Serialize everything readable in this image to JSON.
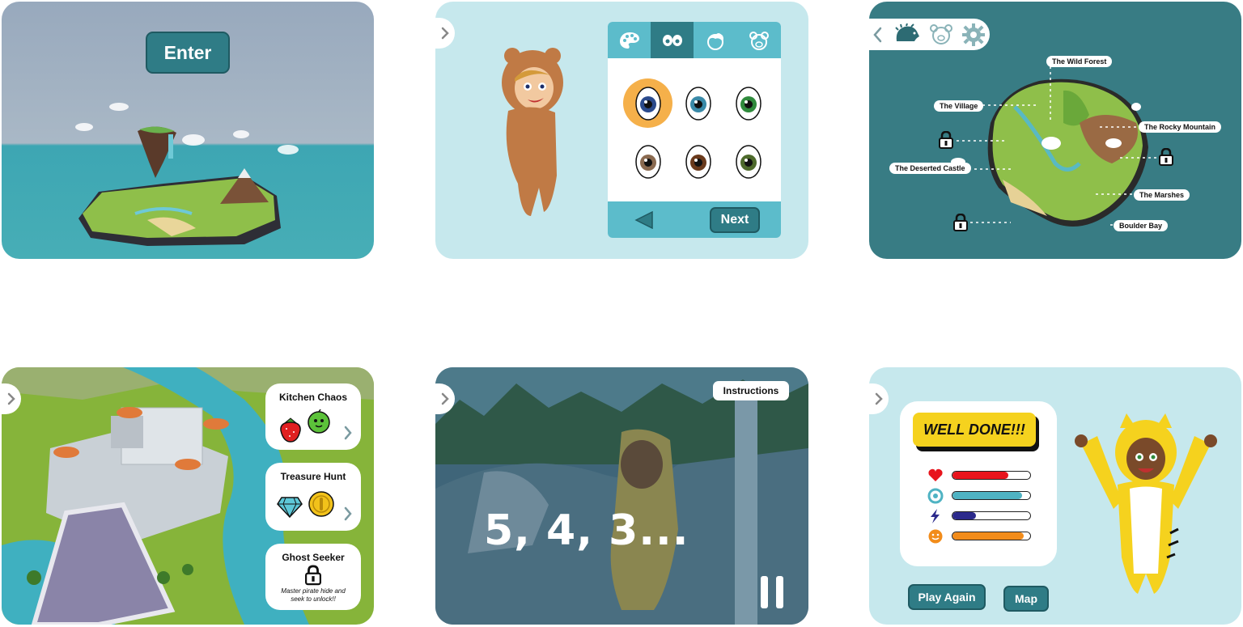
{
  "panels": {
    "enter": {
      "button_label": "Enter"
    },
    "customize": {
      "tabs": [
        {
          "icon": "palette-icon"
        },
        {
          "icon": "eyes-icon",
          "active": true
        },
        {
          "icon": "hair-icon"
        },
        {
          "icon": "bear-face-icon"
        }
      ],
      "eye_colors": [
        "#2a4a8c",
        "#3a8aa8",
        "#2f8a3c",
        "#8a6a50",
        "#6a3a1c",
        "#4e6a2c"
      ],
      "next_label": "Next"
    },
    "map": {
      "locations": [
        {
          "name": "The Wild Forest"
        },
        {
          "name": "The Village"
        },
        {
          "name": "The Rocky Mountain"
        },
        {
          "name": "The Deserted Castle"
        },
        {
          "name": "The Marshes"
        },
        {
          "name": "Boulder Bay"
        }
      ]
    },
    "castle": {
      "games": [
        {
          "title": "Kitchen Chaos"
        },
        {
          "title": "Treasure Hunt"
        },
        {
          "title": "Ghost Seeker",
          "locked_text": "Master pirate hide and seek to unlock!!"
        }
      ]
    },
    "countdown": {
      "instructions_label": "Instructions",
      "countdown_text": "5, 4, 3..."
    },
    "results": {
      "banner": "WELL DONE!!!",
      "stats": [
        {
          "icon": "heart-icon",
          "color": "#e8141c",
          "value": 0.72
        },
        {
          "icon": "target-icon",
          "color": "#4fb3c3",
          "value": 0.9
        },
        {
          "icon": "lightning-icon",
          "color": "#2c2a8c",
          "value": 0.3
        },
        {
          "icon": "smiley-icon",
          "color": "#f28c1a",
          "value": 0.92
        }
      ],
      "play_again_label": "Play Again",
      "map_label": "Map"
    }
  }
}
